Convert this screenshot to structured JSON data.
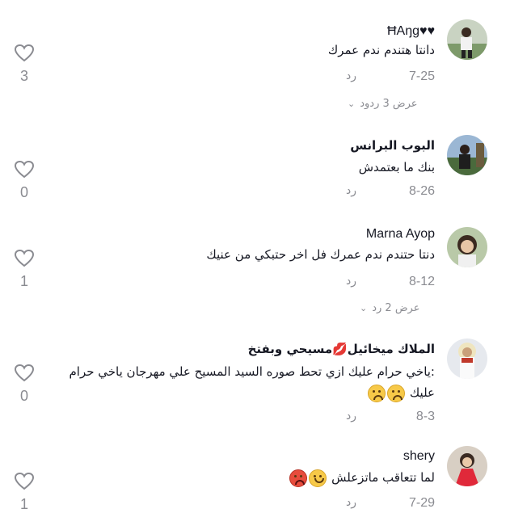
{
  "comments": [
    {
      "username": "♥♥ĦAŋg",
      "text": "دانتا هتندم ندم عمرك",
      "date": "7-25",
      "reply_label": "رد",
      "likes": "3",
      "view_replies": "عرض 3 ردود"
    },
    {
      "username": "البوب البرانس",
      "text": "بنك ما بعتمدش",
      "date": "8-26",
      "reply_label": "رد",
      "likes": "0"
    },
    {
      "username": "Marna Ayop",
      "text": "دنتا حتندم ندم عمرك فل اخر حتبكي من عنيك",
      "date": "8-12",
      "reply_label": "رد",
      "likes": "1",
      "view_replies": "عرض 2 رد"
    },
    {
      "username": "الملاك ميخائيل💋مسيحي وبفتخ",
      "text_line1": ":ياخي حرام عليك ازي تحط صوره السيد المسيح علي مهرجان ياخي حرام",
      "text_line2": "عليك",
      "date": "8-3",
      "reply_label": "رد",
      "likes": "0"
    },
    {
      "username": "shery",
      "text": "لما تتعاقب ماتزعلش",
      "date": "7-29",
      "reply_label": "رد",
      "likes": "1"
    }
  ],
  "icons": {
    "like": "heart-outline-icon",
    "expand": "chevron-down-icon"
  },
  "colors": {
    "text": "#161823",
    "muted": "#8a8b91"
  }
}
